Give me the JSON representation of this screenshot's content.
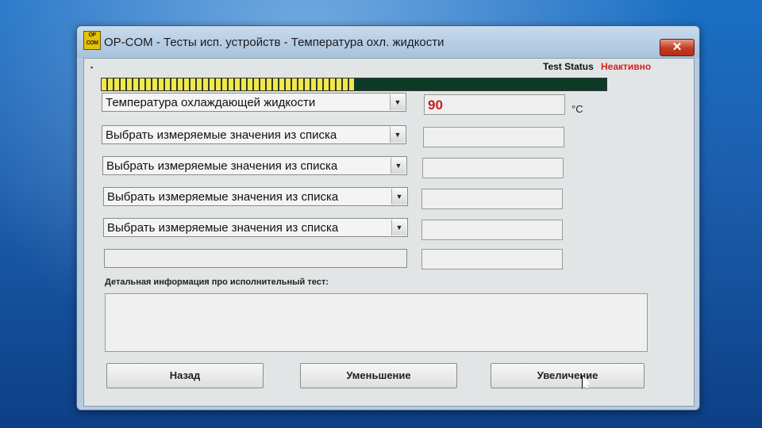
{
  "window": {
    "title": "OP-COM - Тесты исп. устройств - Температура охл. жидкости",
    "icon_text": "OP COM",
    "close_label": "✕"
  },
  "status": {
    "label": "Test Status",
    "value": "Неактивно",
    "value_color": "#d22222"
  },
  "progress": {
    "fraction": 0.5
  },
  "selectors": [
    {
      "label": "Температура охлаждающей жидкости",
      "value": "90"
    },
    {
      "label": "Выбрать измеряемые значения из списка",
      "value": ""
    },
    {
      "label": "Выбрать измеряемые значения из списка",
      "value": ""
    },
    {
      "label": "Выбрать измеряемые значения из списка",
      "value": ""
    },
    {
      "label": "Выбрать измеряемые значения из списка",
      "value": ""
    }
  ],
  "unit": "°C",
  "info": {
    "label": "Детальная информация про исполнительный тест:"
  },
  "buttons": {
    "back": "Назад",
    "decrease": "Уменьшение",
    "increase": "Увеличение"
  },
  "icons": {
    "dropdown": "chevron-down-icon",
    "app": "opcom-icon",
    "close": "close-icon"
  }
}
